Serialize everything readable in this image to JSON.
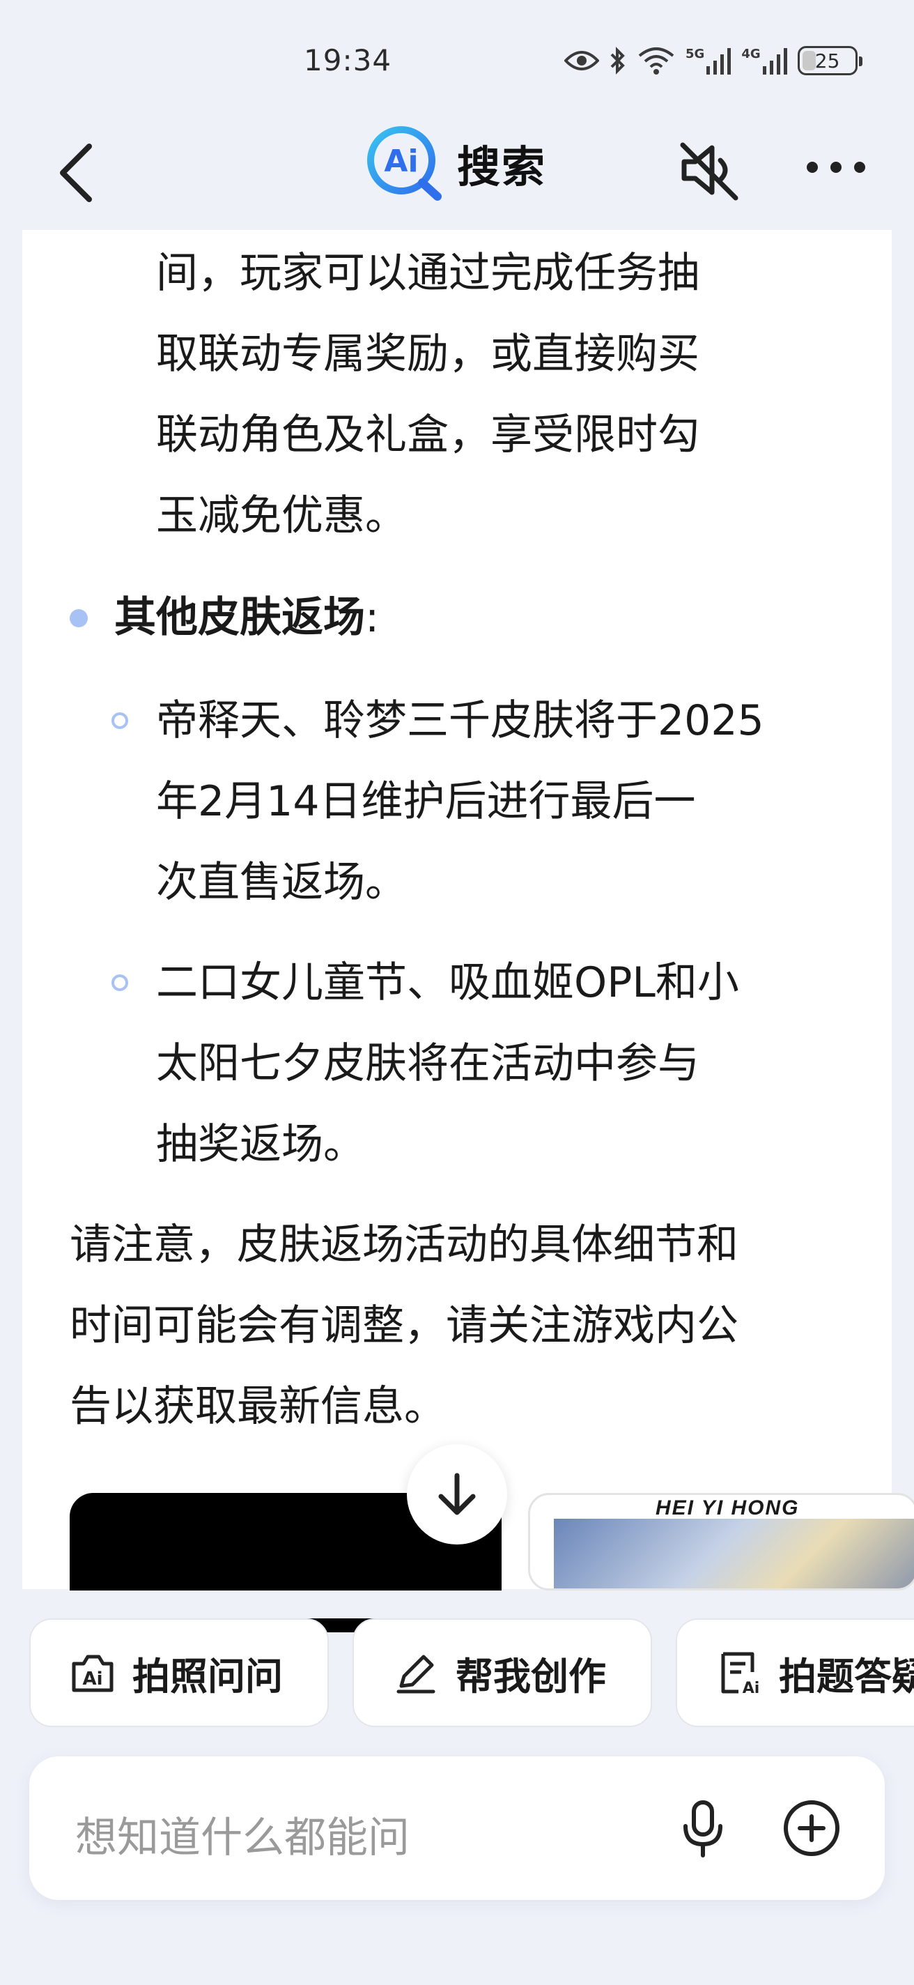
{
  "status_bar": {
    "time": "19:34",
    "battery": "25",
    "signal_labels": [
      "5G",
      "4G"
    ]
  },
  "header": {
    "logo_mark": "Ai",
    "title": "搜索"
  },
  "content": {
    "lines_top": [
      "间，玩家可以通过完成任务抽",
      "取联动专属奖励，或直接购买",
      "联动角色及礼盒，享受限时勾",
      "玉减免优惠。"
    ],
    "section_title": "其他皮肤返场",
    "section_colon": ":",
    "item1_lines": [
      "帝释天、聆梦三千皮肤将于2025",
      "年2月14日维护后进行最后一",
      "次直售返场。"
    ],
    "item2_lines": [
      "二口女儿童节、吸血姬OPL和小",
      "太阳七夕皮肤将在活动中参与",
      "抽奖返场。"
    ],
    "note_lines": [
      "请注意，皮肤返场活动的具体细节和",
      "时间可能会有调整，请关注游戏内公",
      "告以获取最新信息。"
    ],
    "image_caption": "HEI YI HONG"
  },
  "chips": [
    {
      "label": "拍照问问",
      "icon": "camera-ai-icon"
    },
    {
      "label": "帮我创作",
      "icon": "pen-icon"
    },
    {
      "label": "拍题答疑",
      "icon": "doc-ai-icon"
    }
  ],
  "input": {
    "placeholder": "想知道什么都能问"
  },
  "colors": {
    "background": "#eef1f8",
    "bullet": "#a9c2f5",
    "logo_blue": "#2f6fec",
    "logo_cyan": "#39c3f0"
  }
}
